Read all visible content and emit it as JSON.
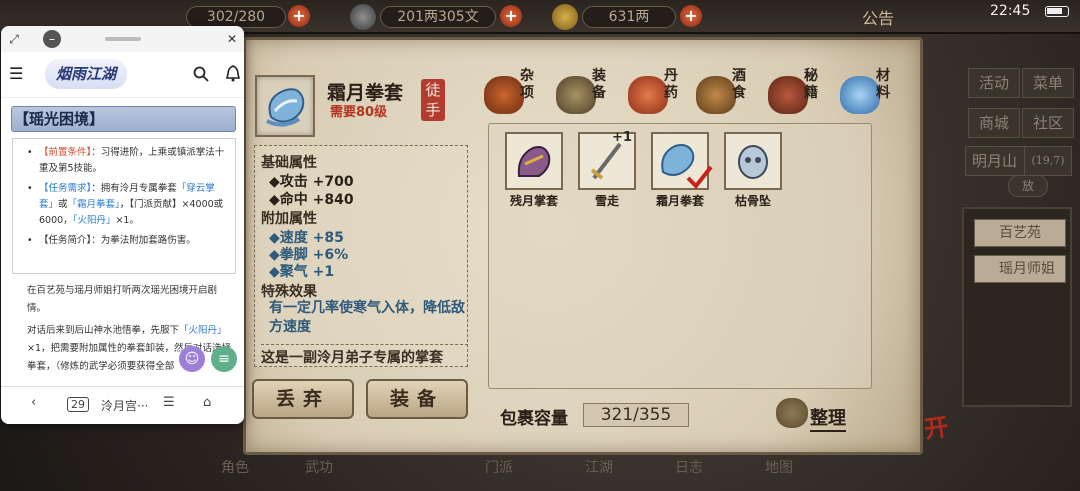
{
  "status_bar": {
    "stamina": "302/280",
    "coins": "201两305文",
    "gold": "631两",
    "announce": "公告",
    "time": "22:45"
  },
  "side_menu": {
    "activity": "活动",
    "menu": "菜单",
    "shop": "商城",
    "community": "社区",
    "location": "明月山",
    "coords": "(19,7)",
    "release": "放",
    "npc_panel": [
      "百艺苑",
      "瑶月师姐"
    ]
  },
  "item": {
    "name": "霜月拳套",
    "level_req": "需要80级",
    "seal": "徒手"
  },
  "tabs": [
    {
      "label": "杂项",
      "color": "#9a4a22"
    },
    {
      "label": "装备",
      "color": "#6b5a3a"
    },
    {
      "label": "丹药",
      "color": "#c2542e"
    },
    {
      "label": "酒食",
      "color": "#8a5a2a"
    },
    {
      "label": "秘籍",
      "color": "#8a3a2a"
    },
    {
      "label": "材料",
      "color": "#4a8ac8"
    }
  ],
  "detail": {
    "base_title": "基础属性",
    "base": [
      "◆攻击 +700",
      "◆命中 +840"
    ],
    "extra_title": "附加属性",
    "extra": [
      "◆速度 +85",
      "◆拳脚 +6%",
      "◆聚气 +1"
    ],
    "special_title": "特殊效果",
    "special_desc": "有一定几率使寒气入体，降低敌方速度",
    "flavor": "这是一副泠月弟子专属的掌套"
  },
  "bag": {
    "items": [
      {
        "name": "残月掌套",
        "icon": "gauntlet-icon"
      },
      {
        "name": "雪走",
        "icon": "sword-icon",
        "badge": "+1"
      },
      {
        "name": "霜月拳套",
        "icon": "frost-gauntlet-icon",
        "equipped": true
      },
      {
        "name": "枯骨坠",
        "icon": "skull-pendant-icon"
      }
    ],
    "capacity_label": "包裹容量",
    "capacity": "321/355",
    "sort_label": "整理"
  },
  "buttons": {
    "discard": "丢弃",
    "equip": "装备"
  },
  "bottom_nav": [
    "角色",
    "武功",
    "门派",
    "江湖",
    "日志",
    "地图"
  ],
  "brand": "离开",
  "popup": {
    "logo": "烟雨江湖",
    "heading": "【瑶光困境】",
    "prereq_label": "【前置条件】",
    "prereq_text": "：习得进阶，上乘或镇派掌法十重及第5技能。",
    "task_label": "【任务需求】",
    "task_text_1": "：拥有泠月专属拳套",
    "task_link_1": "「穿云掌套」",
    "task_text_2": "或",
    "task_link_2": "「霜月拳套」",
    "task_text_3": "，【门派贡献】×4000或6000，",
    "task_link_3": "「火阳丹」",
    "task_text_4": "×1。",
    "summary_label": "【任务简介】",
    "summary_text": "：为拳法附加套路伤害。",
    "para1": "在百艺苑与瑶月师姐打听两次瑶光困境开启剧情。",
    "para2_a": "对话后来到后山神水池悟拳，先服下",
    "para2_link": "「火阳丹」",
    "para2_b": "×1，把需要附加属性的拳套卸装，然后对话选择拳套，（修炼的武学必须要获得全部",
    "bottom_title": "泠月宫···",
    "tab_count": "29"
  }
}
